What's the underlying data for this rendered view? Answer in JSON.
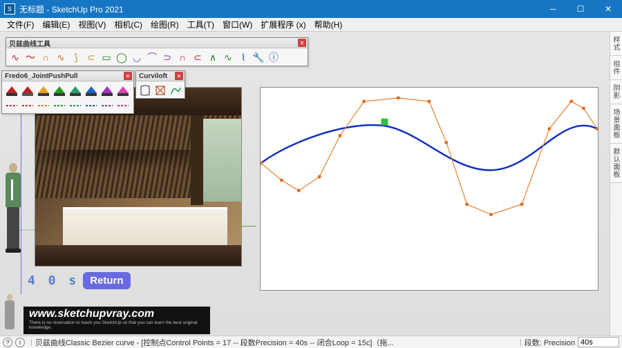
{
  "title": "无标题 - SketchUp Pro 2021",
  "menu": {
    "file": "文件(F)",
    "edit": "编辑(E)",
    "view": "视图(V)",
    "camera": "相机(C)",
    "draw": "绘图(R)",
    "tools": "工具(T)",
    "window": "窗口(W)",
    "extensions": "扩展程序 (x)",
    "help": "帮助(H)"
  },
  "toolbars": {
    "bezier": {
      "title": "贝兹曲线工具"
    },
    "jpp": {
      "title": "Fredo6_JointPushPull"
    },
    "curviloft": {
      "title": "Curviloft"
    }
  },
  "trays": {
    "t1": "样式",
    "t2": "组件",
    "t3": "阴影",
    "t4": "场景面板",
    "t5": "默认面板"
  },
  "overlay": {
    "value": "4 0 s",
    "button": "Return"
  },
  "watermark": {
    "url": "www.sketchupvray.com",
    "sub": "There is no reservation to teach you SketchUp so that you can learn the best original knowledge."
  },
  "status": {
    "help_icon": "?",
    "info_icon": "i",
    "text": "贝兹曲线Classic Bezier curve - [控制点Control Points = 17  -- 段数Precision = 40s  -- 闭合Loop = 15c]（拖...",
    "sep": "|",
    "label": "段数: Precision",
    "value": "40s"
  }
}
